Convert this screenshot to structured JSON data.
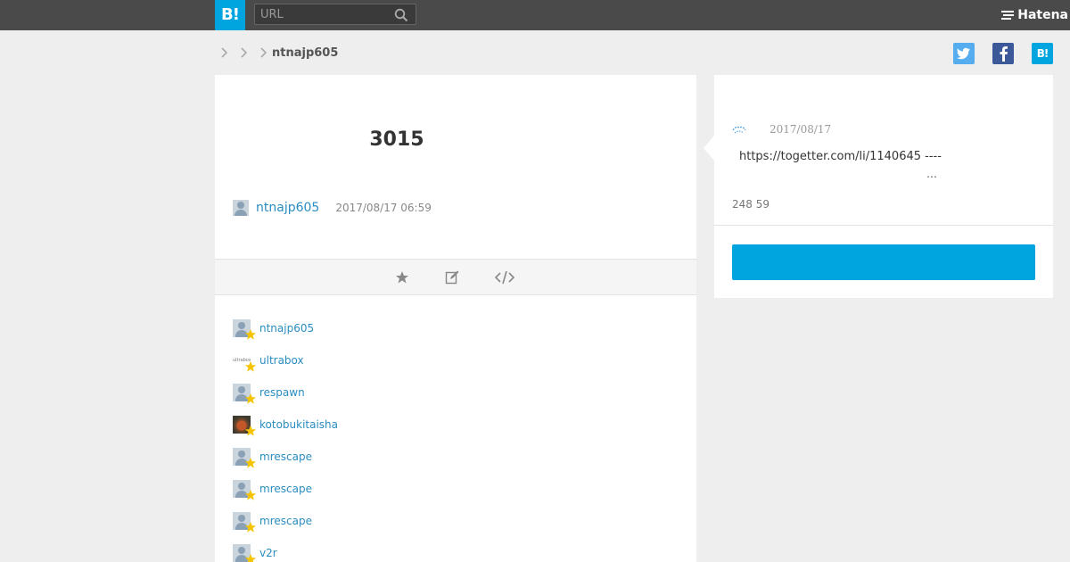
{
  "header": {
    "logo_text": "B!",
    "search_placeholder": "URL",
    "brand": "Hatena"
  },
  "breadcrumb": {
    "current": "ntnajp605"
  },
  "share": {
    "twitter_glyph": "t",
    "facebook_glyph": "f",
    "hatena_glyph": "B!"
  },
  "entry": {
    "title": "3015",
    "author": "ntnajp605",
    "datetime": "2017/08/17 06:59"
  },
  "users": [
    {
      "name": "ntnajp605",
      "avatar": "default"
    },
    {
      "name": "ultrabox",
      "avatar": "text",
      "avatar_text": "ultrabox"
    },
    {
      "name": "respawn",
      "avatar": "default"
    },
    {
      "name": "kotobukitaisha",
      "avatar": "photo"
    },
    {
      "name": "mrescape",
      "avatar": "default"
    },
    {
      "name": "mrescape",
      "avatar": "default"
    },
    {
      "name": "mrescape",
      "avatar": "default"
    },
    {
      "name": "v2r",
      "avatar": "default"
    }
  ],
  "side": {
    "date": "2017/08/17",
    "url": "https://togetter.com/li/1140645 ----",
    "ellipsis": "…",
    "counts": "248 59",
    "button_label": ""
  },
  "colors": {
    "accent": "#00a4de",
    "link": "#2a8dc1",
    "topbar": "#4a4a4a",
    "star": "#f5c400"
  }
}
